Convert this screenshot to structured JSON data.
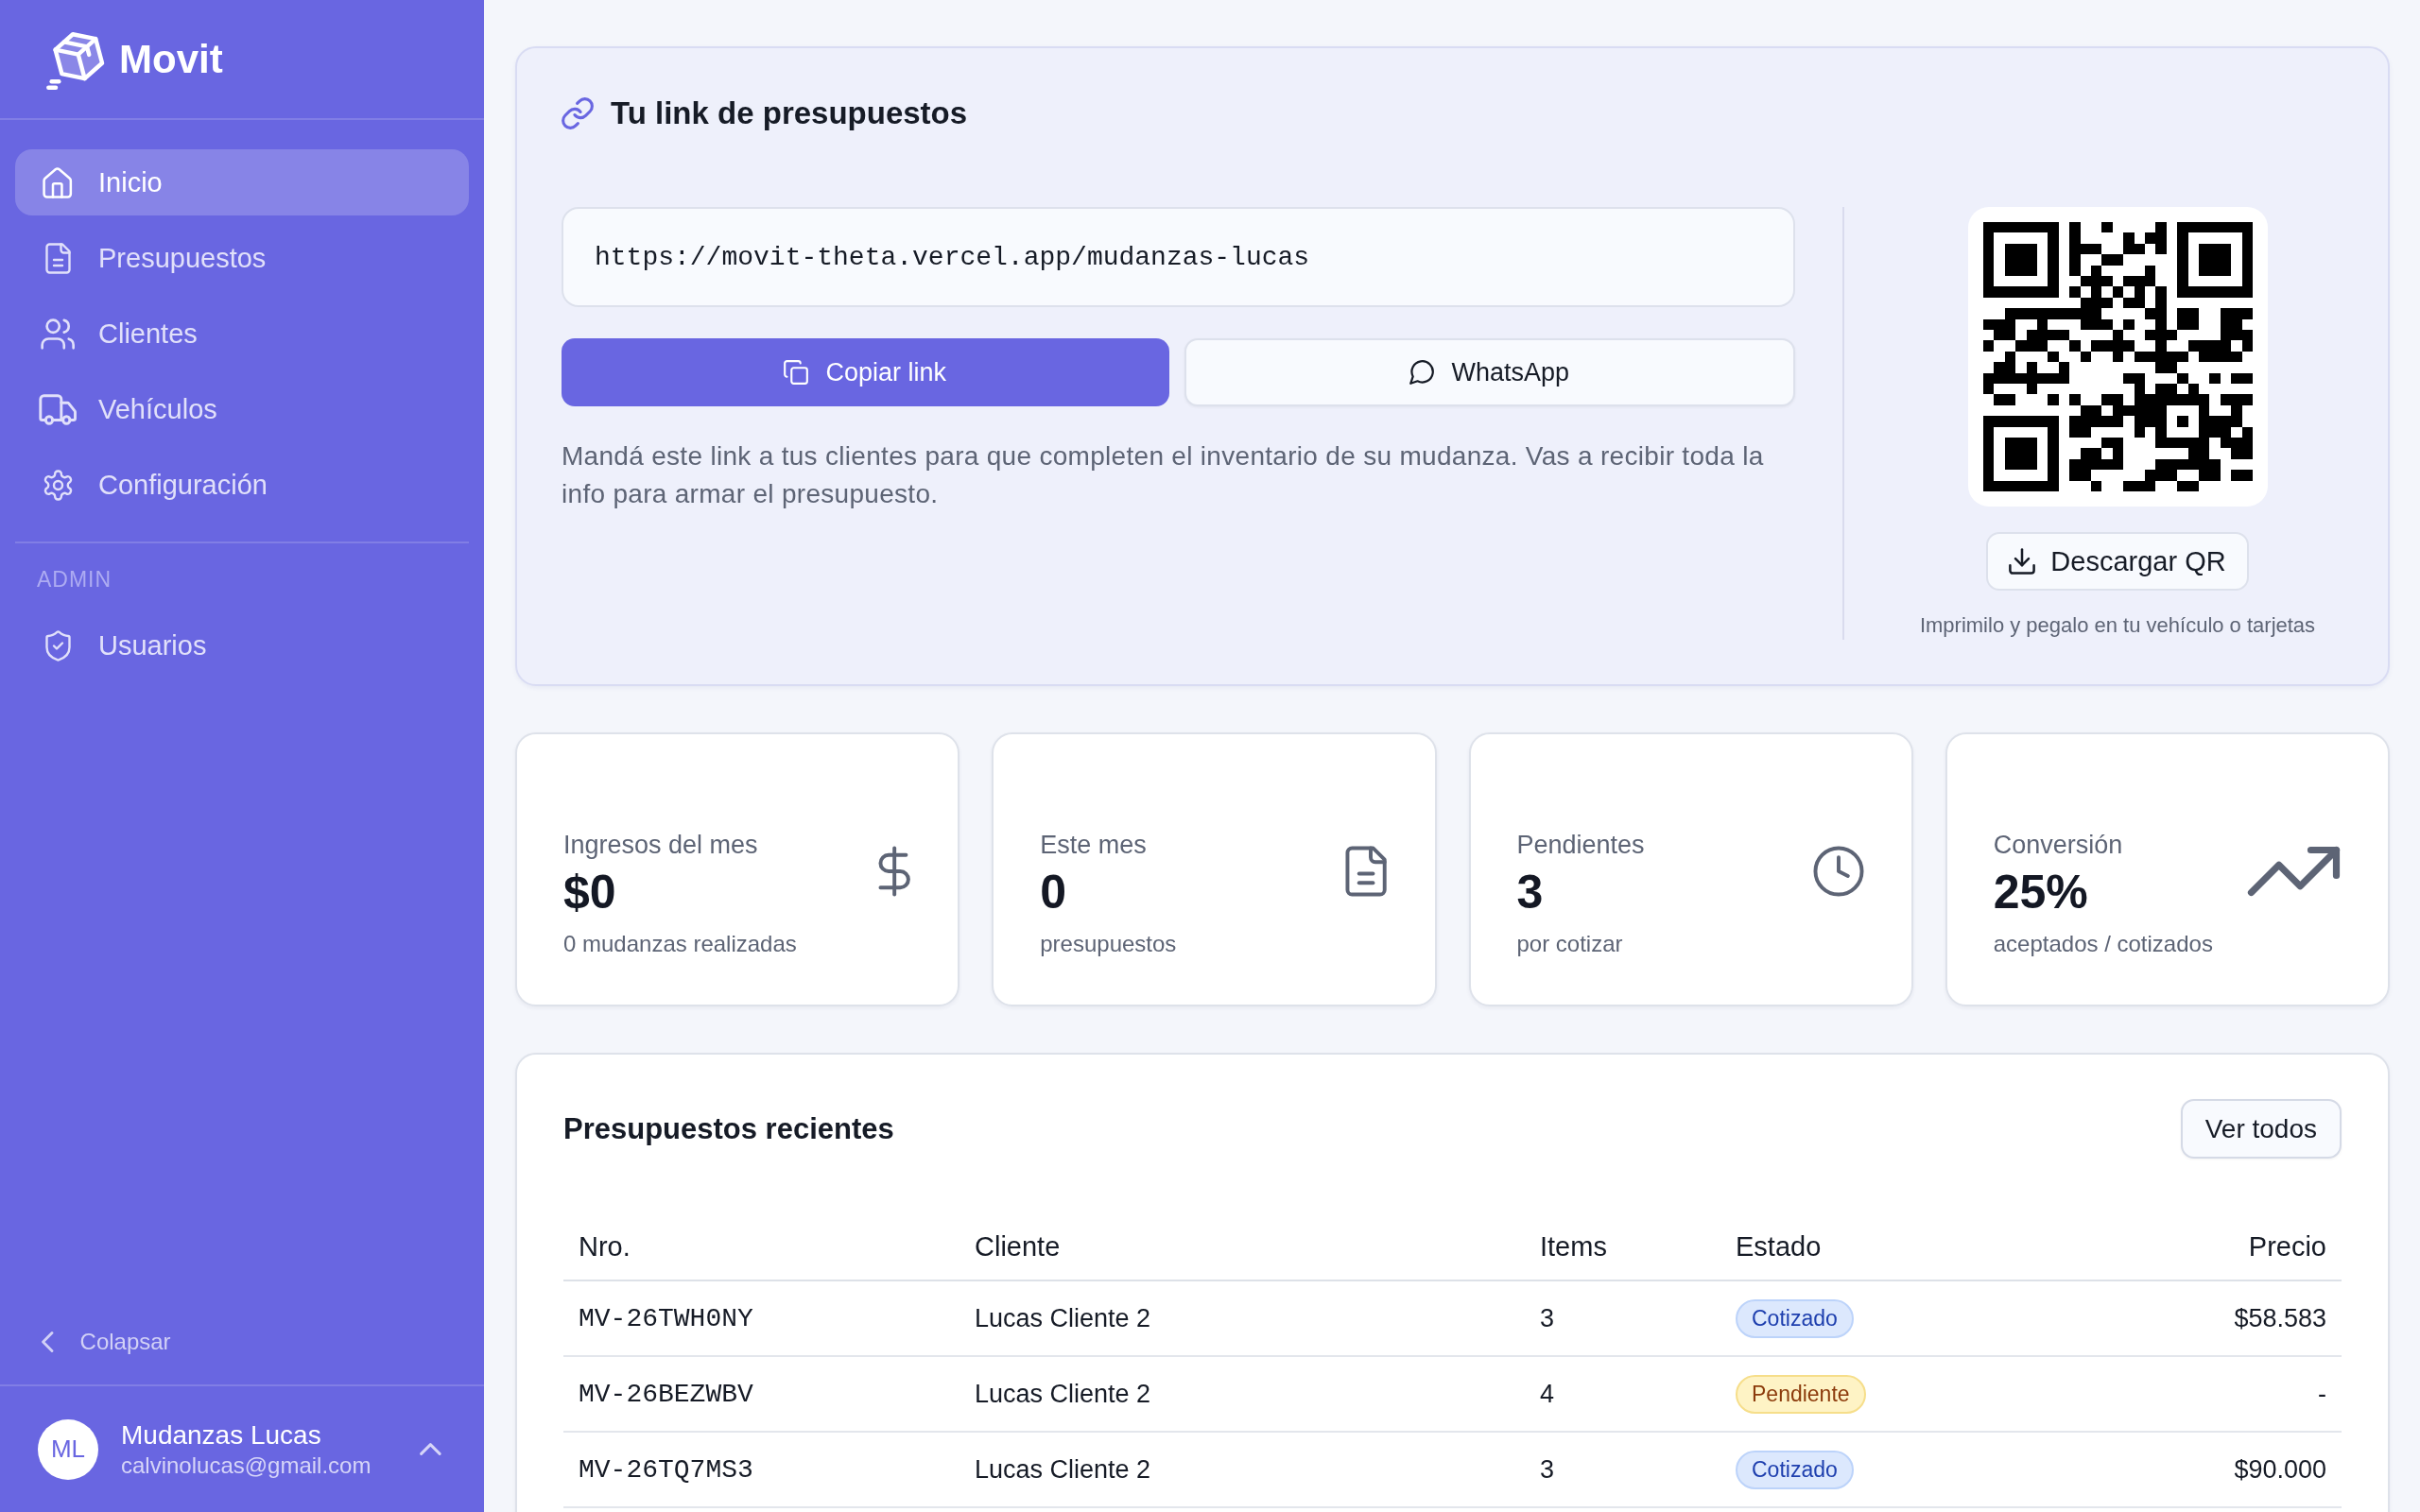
{
  "sidebar": {
    "brand": "Movit",
    "nav": [
      {
        "label": "Inicio",
        "selected": true
      },
      {
        "label": "Presupuestos",
        "selected": false
      },
      {
        "label": "Clientes",
        "selected": false
      },
      {
        "label": "Vehículos",
        "selected": false
      },
      {
        "label": "Configuración",
        "selected": false
      }
    ],
    "section_heading": "ADMIN",
    "admin_nav": [
      {
        "label": "Usuarios",
        "selected": false
      }
    ],
    "collapse_button": "Colapsar",
    "user": {
      "initials": "ML",
      "name": "Mudanzas Lucas",
      "email": "calvinolucas@gmail.com"
    }
  },
  "link_card": {
    "title": "Tu link de presupuestos",
    "url": "https://movit-theta.vercel.app/mudanzas-lucas",
    "buttons": [
      {
        "label": "Copiar link",
        "kind": "primary"
      },
      {
        "label": "WhatsApp",
        "kind": "outline"
      }
    ],
    "description": "Mandá este link a tus clientes para que completen el inventario de su mudanza. Vas a recibir toda la info para armar el presupuesto.",
    "qr_button": "Descargar QR",
    "qr_caption": "Imprimilo y pegalo en tu vehículo o tarjetas"
  },
  "stats": [
    {
      "label": "Ingresos del mes",
      "value": "$0",
      "note": "0 mudanzas realizadas"
    },
    {
      "label": "Este mes",
      "value": "0",
      "note": "presupuestos"
    },
    {
      "label": "Pendientes",
      "value": "3",
      "note": "por cotizar"
    },
    {
      "label": "Conversión",
      "value": "25%",
      "note": "aceptados / cotizados"
    }
  ],
  "recent_quotes": {
    "title": "Presupuestos recientes",
    "view_all_button": "Ver todos",
    "columns": [
      "Nro.",
      "Cliente",
      "Items",
      "Estado",
      "Precio"
    ],
    "rows": [
      {
        "nro": "MV-26TWH0NY",
        "cliente": "Lucas Cliente 2",
        "items": "3",
        "estado": {
          "label": "Cotizado",
          "kind": "quoted"
        },
        "precio": "$58.583"
      },
      {
        "nro": "MV-26BEZWBV",
        "cliente": "Lucas Cliente 2",
        "items": "4",
        "estado": {
          "label": "Pendiente",
          "kind": "pending"
        },
        "precio": "-"
      },
      {
        "nro": "MV-26TQ7MS3",
        "cliente": "Lucas Cliente 2",
        "items": "3",
        "estado": {
          "label": "Cotizado",
          "kind": "quoted"
        },
        "precio": "$90.000"
      }
    ]
  }
}
